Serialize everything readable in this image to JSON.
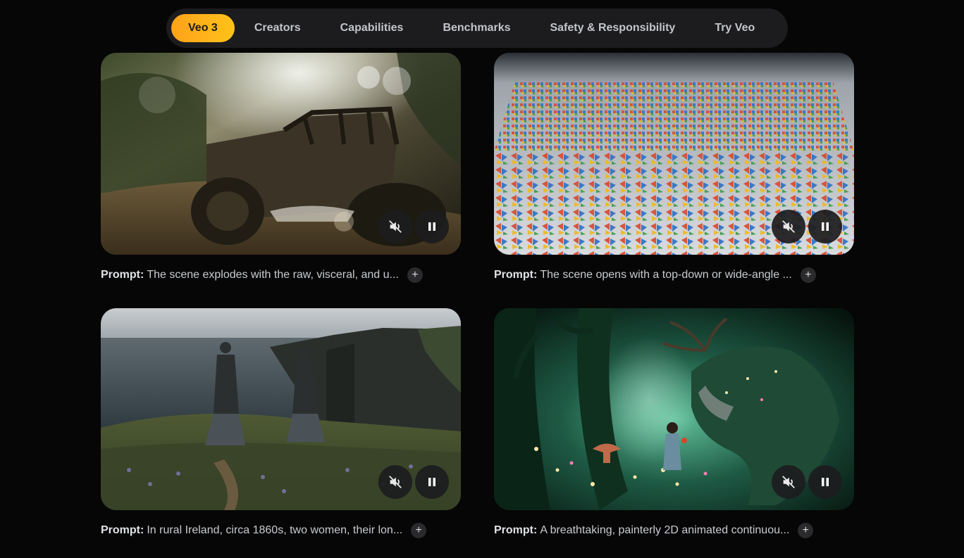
{
  "nav": {
    "items": [
      {
        "label": "Veo 3",
        "active": true
      },
      {
        "label": "Creators",
        "active": false
      },
      {
        "label": "Capabilities",
        "active": false
      },
      {
        "label": "Benchmarks",
        "active": false
      },
      {
        "label": "Safety & Responsibility",
        "active": false
      },
      {
        "label": "Try Veo",
        "active": false
      }
    ],
    "accent_gradient": [
      "#ffa21a",
      "#ffc21a"
    ]
  },
  "videos": [
    {
      "prompt_label": "Prompt:",
      "prompt_text": "The scene explodes with the raw, visceral, and u...",
      "mute_icon": "volume-off-icon",
      "pause_icon": "pause-icon",
      "expand_label": "+"
    },
    {
      "prompt_label": "Prompt:",
      "prompt_text": "The scene opens with a top-down or wide-angle ...",
      "mute_icon": "volume-off-icon",
      "pause_icon": "pause-icon",
      "expand_label": "+"
    },
    {
      "prompt_label": "Prompt:",
      "prompt_text": "In rural Ireland, circa 1860s, two women, their lon...",
      "mute_icon": "volume-off-icon",
      "pause_icon": "pause-icon",
      "expand_label": "+"
    },
    {
      "prompt_label": "Prompt:",
      "prompt_text": "A breathtaking, painterly 2D animated continuou...",
      "mute_icon": "volume-off-icon",
      "pause_icon": "pause-icon",
      "expand_label": "+"
    }
  ]
}
